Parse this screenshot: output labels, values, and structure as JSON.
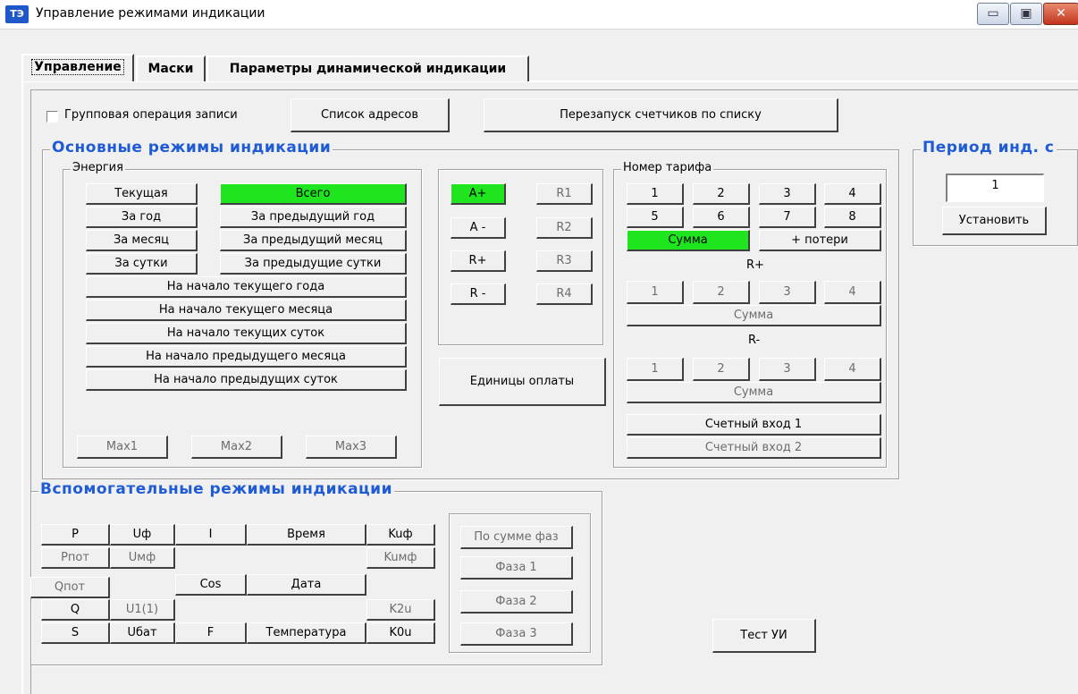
{
  "window": {
    "title": "Управление режимами индикации",
    "icon_text": "ТЭ",
    "controls": {
      "minimize": "▭",
      "maximize": "▣",
      "close": "✕"
    }
  },
  "tabs": {
    "control": "Управление",
    "masks": "Маски",
    "dynamic": "Параметры динамической индикации"
  },
  "top_row": {
    "group_write_label": "Групповая операция записи",
    "address_list": "Список адресов",
    "restart_meters": "Перезапуск счетчиков по списку"
  },
  "main_modes": {
    "title": "Основные режимы индикации",
    "energy": {
      "title": "Энергия",
      "current": "Текущая",
      "total": "Всего",
      "year": "За год",
      "prev_year": "За предыдущий год",
      "month": "За месяц",
      "prev_month": "За предыдущий месяц",
      "day": "За сутки",
      "prev_day": "За предыдущие сутки",
      "start_cur_year": "На начало текущего года",
      "start_cur_month": "На начало текущего месяца",
      "start_cur_day": "На начало текущих суток",
      "start_prev_month": "На начало предыдущего месяца",
      "start_prev_day": "На начало предыдущих суток",
      "max1": "Max1",
      "max2": "Max2",
      "max3": "Max3"
    },
    "energy_type": {
      "a_plus": "A+",
      "a_minus": "A -",
      "r_plus": "R+",
      "r_minus": "R -",
      "r1": "R1",
      "r2": "R2",
      "r3": "R3",
      "r4": "R4"
    },
    "payment_units": "Единицы оплаты",
    "tariff": {
      "title": "Номер тарифа",
      "t1": "1",
      "t2": "2",
      "t3": "3",
      "t4": "4",
      "t5": "5",
      "t6": "6",
      "t7": "7",
      "t8": "8",
      "sum": "Сумма",
      "losses": "+ потери",
      "r_plus_label": "R+",
      "rp1": "1",
      "rp2": "2",
      "rp3": "3",
      "rp4": "4",
      "rp_sum": "Сумма",
      "r_minus_label": "R-",
      "rm1": "1",
      "rm2": "2",
      "rm3": "3",
      "rm4": "4",
      "rm_sum": "Сумма",
      "input1": "Счетный вход 1",
      "input2": "Счетный вход 2"
    }
  },
  "period": {
    "title": "Период инд. с",
    "value": "1",
    "set": "Установить"
  },
  "aux_modes": {
    "title": "Вспомогательные режимы индикации",
    "p": "P",
    "uf": "Uф",
    "i": "I",
    "time": "Время",
    "kuf": "Kuф",
    "ppot": "Рпот",
    "umf": "Uмф",
    "kumf": "Kuмф",
    "qpot": "Qпот",
    "cos": "Cos",
    "date": "Дата",
    "q": "Q",
    "u11": "U1(1)",
    "k2u": "K2u",
    "s": "S",
    "ubat": "Uбат",
    "f": "F",
    "temperature": "Температура",
    "k0u": "K0u",
    "phase_sum": "По сумме фаз",
    "phase1": "Фаза 1",
    "phase2": "Фаза 2",
    "phase3": "Фаза 3"
  },
  "test_ui": "Тест УИ"
}
